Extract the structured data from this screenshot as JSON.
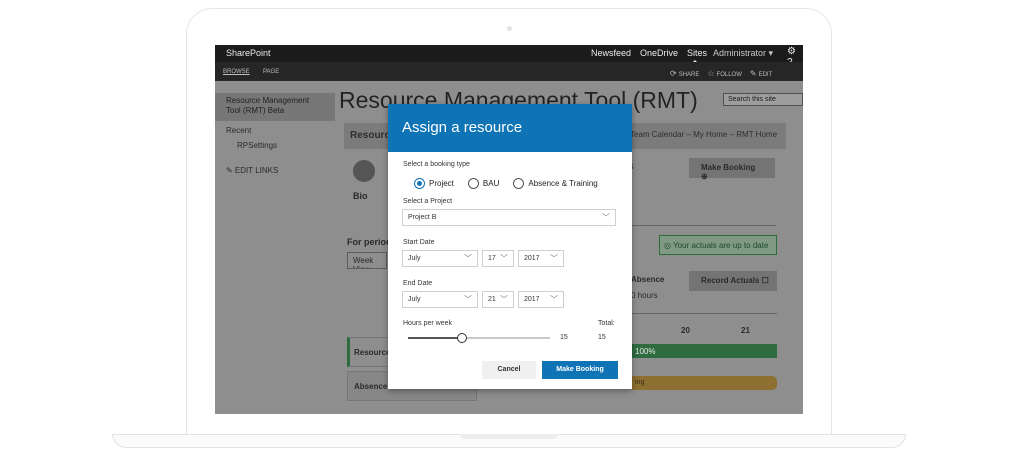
{
  "suite": {
    "brand": "SharePoint",
    "links": [
      "Newsfeed",
      "OneDrive",
      "Sites"
    ],
    "user": "Administrator ▾",
    "gear": "⚙ ?"
  },
  "ribbon": {
    "tabs": [
      "BROWSE",
      "PAGE"
    ],
    "actions": [
      {
        "icon": "share-icon",
        "glyph": "⟳",
        "label": "SHARE"
      },
      {
        "icon": "follow-icon",
        "glyph": "☆",
        "label": "FOLLOW"
      },
      {
        "icon": "edit-icon",
        "glyph": "✎",
        "label": "EDIT"
      }
    ]
  },
  "nav": {
    "selected": "Resource Management Tool (RMT) Beta",
    "recent": "Recent",
    "sub": "RPSettings",
    "edit_links": "✎ EDIT LINKS"
  },
  "page": {
    "title": "Resource Management Tool (RMT)",
    "search_placeholder": "Search this site",
    "band_label": "Resource",
    "breadcrumb": "Team Calendar – My Home – RMT Home",
    "bio": "Bio",
    "period": "For period",
    "week_view": "Week View",
    "make_booking": "Make Booking ⊕",
    "actuals": "Your actuals are up to date",
    "absence": "Absence",
    "hours": "0 hours",
    "record_actuals": "Record Actuals",
    "day_20": "20",
    "day_21": "21",
    "pct": "100%",
    "row1": "Resource",
    "row2": "Absence",
    "orange": "ing"
  },
  "modal": {
    "title": "Assign a resource",
    "booking_type_label": "Select a booking type",
    "booking_types": [
      "Project",
      "BAU",
      "Absence & Training"
    ],
    "selected_type": "Project",
    "project_label": "Select a Project",
    "project_value": "Project B",
    "start_label": "Start Date",
    "start": {
      "month": "July",
      "day": "17",
      "year": "2017"
    },
    "end_label": "End Date",
    "end": {
      "month": "July",
      "day": "21",
      "year": "2017"
    },
    "hours_label": "Hours per week",
    "total_label": "Total:",
    "hours_value": "15",
    "total_value": "15",
    "hours_fraction": 0.38,
    "cancel": "Cancel",
    "submit": "Make Booking"
  },
  "colors": {
    "accent": "#0e74b6",
    "success": "#2e6b3f",
    "warning": "#8c6f31"
  }
}
